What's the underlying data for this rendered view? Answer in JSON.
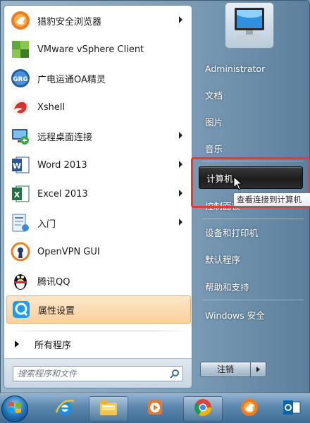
{
  "programs": [
    {
      "label": "猎豹安全浏览器",
      "icon": "liebao-browser-icon",
      "has_arrow": true
    },
    {
      "label": "VMware vSphere Client",
      "icon": "vmware-icon",
      "has_arrow": false
    },
    {
      "label": "广电运通OA精灵",
      "icon": "grgbanking-oa-icon",
      "has_arrow": false
    },
    {
      "label": "Xshell",
      "icon": "xshell-icon",
      "has_arrow": false
    },
    {
      "label": "远程桌面连接",
      "icon": "remote-desktop-icon",
      "has_arrow": true
    },
    {
      "label": "Word 2013",
      "icon": "word-icon",
      "has_arrow": true
    },
    {
      "label": "Excel 2013",
      "icon": "excel-icon",
      "has_arrow": true
    },
    {
      "label": "入门",
      "icon": "getting-started-icon",
      "has_arrow": true
    },
    {
      "label": "OpenVPN GUI",
      "icon": "openvpn-icon",
      "has_arrow": false
    },
    {
      "label": "腾讯QQ",
      "icon": "qq-penguin-icon",
      "has_arrow": false
    },
    {
      "label": "属性设置",
      "icon": "qq-settings-icon",
      "has_arrow": false,
      "highlighted": true
    }
  ],
  "all_programs_label": "所有程序",
  "search": {
    "placeholder": "搜索程序和文件"
  },
  "places": [
    {
      "label": "Administrator"
    },
    {
      "label": "文档"
    },
    {
      "label": "图片"
    },
    {
      "label": "音乐"
    },
    {
      "label": "计算机",
      "hovered": true
    },
    {
      "label": "控制面板"
    },
    {
      "label": "设备和打印机"
    },
    {
      "label": "默认程序"
    },
    {
      "label": "帮助和支持"
    },
    {
      "label": "Windows 安全"
    }
  ],
  "tooltip": "查看连接到计算机",
  "logoff_label": "注销",
  "taskbar": [
    {
      "name": "ie-icon"
    },
    {
      "name": "explorer-icon"
    },
    {
      "name": "media-player-icon"
    },
    {
      "name": "chrome-icon"
    },
    {
      "name": "liebao-icon"
    },
    {
      "name": "outlook-icon"
    }
  ],
  "colors": {
    "highlight": "#fbd19d",
    "red_box": "#e53935",
    "places_text": "#ffffff"
  }
}
